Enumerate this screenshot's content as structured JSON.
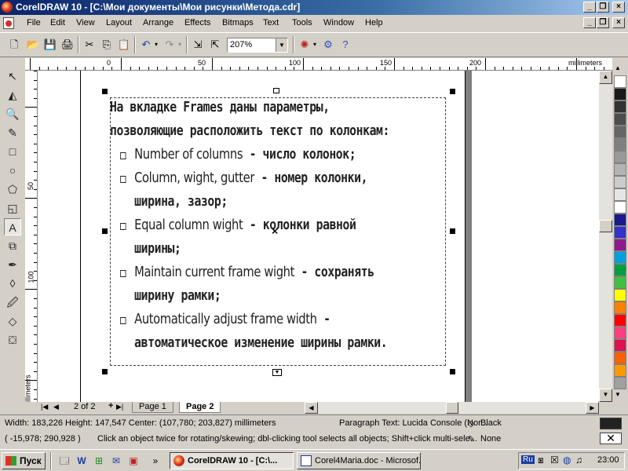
{
  "window": {
    "title": "CorelDRAW 10 - [C:\\Мои документы\\Мои рисунки\\Метода.cdr]"
  },
  "menu": [
    "File",
    "Edit",
    "View",
    "Layout",
    "Arrange",
    "Effects",
    "Bitmaps",
    "Text",
    "Tools",
    "Window",
    "Help"
  ],
  "toolbar": {
    "zoom": "207%"
  },
  "rulers": {
    "h_labels": [
      "0",
      "50",
      "100",
      "150",
      "200"
    ],
    "h_unit": "millimeters",
    "v_labels": [
      "50",
      "100"
    ],
    "v_unit": "millimeters"
  },
  "document": {
    "intro": "На вкладке Frames даны параметры, позволяющие расположить текст по колонкам:",
    "items": [
      {
        "en": "Number of columns",
        "ru": " - число колонок;"
      },
      {
        "en": "Column, wight, gutter",
        "ru": " - номер колонки, ширина, зазор;"
      },
      {
        "en": "Equal column wight",
        "ru": " - колонки равной ширины;"
      },
      {
        "en": "Maintain current frame wight",
        "ru": " - сохранять ширину рамки;"
      },
      {
        "en": "Automatically adjust frame width",
        "ru": " - автоматическое изменение ширины рамки."
      }
    ]
  },
  "pagenav": {
    "counter": "2 of 2",
    "tabs": [
      "Page 1",
      "Page 2"
    ],
    "active_tab": "Page 2"
  },
  "status": {
    "size": "Width: 183,226  Height: 147,547  Center: (107,780; 203,827)  millimeters",
    "object": "Paragraph Text: Lucida Console (Nor...",
    "fill": "Black",
    "coords": "( -15,978; 290,928 )",
    "hint": "Click an object twice for rotating/skewing; dbl-clicking tool selects all objects; Shift+click multi-sele...",
    "outline": "None"
  },
  "taskbar": {
    "start": "Пуск",
    "tasks": [
      "CorelDRAW 10 - [C:\\...",
      "Corel4Maria.doc - Microsof..."
    ],
    "lang": "Ru",
    "clock": "23:00"
  },
  "palette_colors": [
    "#ffffff",
    "#1a1a1a",
    "#333333",
    "#4d4d4d",
    "#666666",
    "#808080",
    "#999999",
    "#b3b3b3",
    "#cccccc",
    "#e6e6e6",
    "#ffffff",
    "#1a1a8c",
    "#3333cc",
    "#8c1a8c",
    "#00a0e0",
    "#00a040",
    "#40c040",
    "#ffff00",
    "#ff8000",
    "#ff0000",
    "#ff4080",
    "#e01050",
    "#ff6000",
    "#ff9900",
    "#a0a0a0"
  ],
  "colors": {
    "titlebar": "#0a246a",
    "fill_swatch": "#000000"
  }
}
